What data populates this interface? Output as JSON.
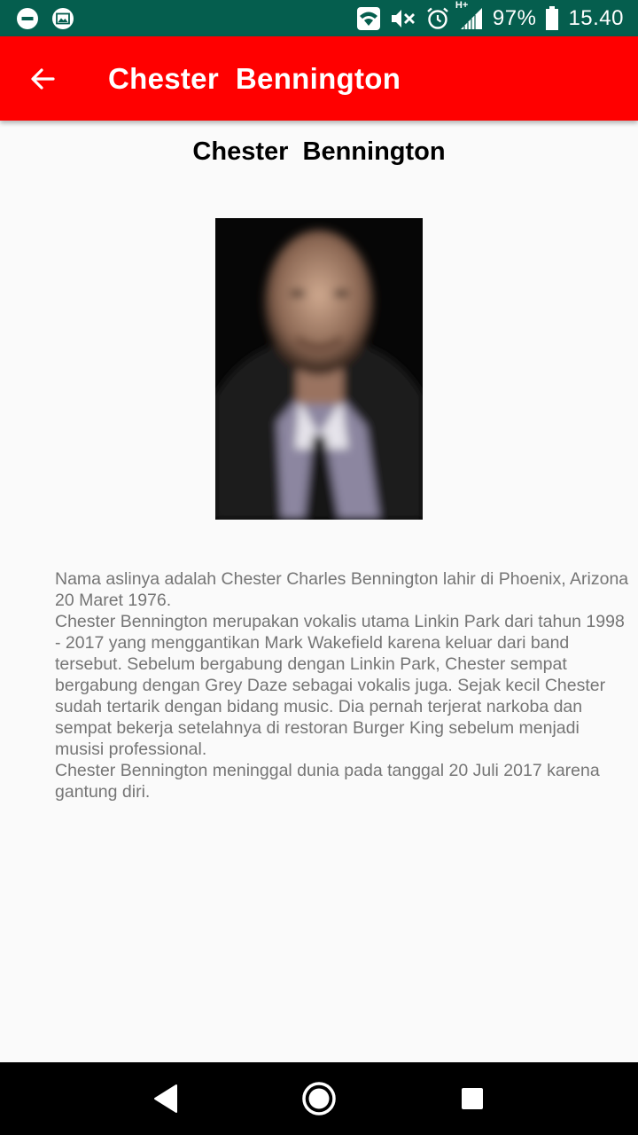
{
  "status_bar": {
    "left_icons": [
      "do-not-disturb-icon",
      "image-icon"
    ],
    "right_icons": [
      "wifi-icon",
      "mute-icon",
      "alarm-icon",
      "signal-icon",
      "battery-icon"
    ],
    "network_type": "H+",
    "battery": "97%",
    "time": "15.40",
    "background": "#055e4e"
  },
  "app_bar": {
    "title": "Chester  Bennington",
    "back_icon": "arrow-back-icon",
    "background": "#ff0000"
  },
  "content": {
    "heading": "Chester  Bennington",
    "photo_icon": "person-photo",
    "bio": "Nama aslinya adalah Chester Charles Bennington lahir di Phoenix, Arizona 20 Maret 1976.\n Chester Bennington merupakan vokalis utama Linkin Park dari tahun 1998 - 2017 yang menggantikan Mark Wakefield karena keluar dari band tersebut. Sebelum bergabung dengan Linkin Park, Chester sempat bergabung dengan Grey Daze sebagai vokalis juga. Sejak kecil Chester sudah tertarik dengan bidang music. Dia pernah terjerat narkoba dan sempat bekerja setelahnya di restoran Burger King sebelum menjadi musisi professional.\nChester Bennington meninggal dunia pada tanggal 20 Juli 2017 karena gantung diri."
  },
  "nav_bar": {
    "buttons": [
      "back-triangle-icon",
      "home-circle-icon",
      "recents-square-icon"
    ]
  }
}
